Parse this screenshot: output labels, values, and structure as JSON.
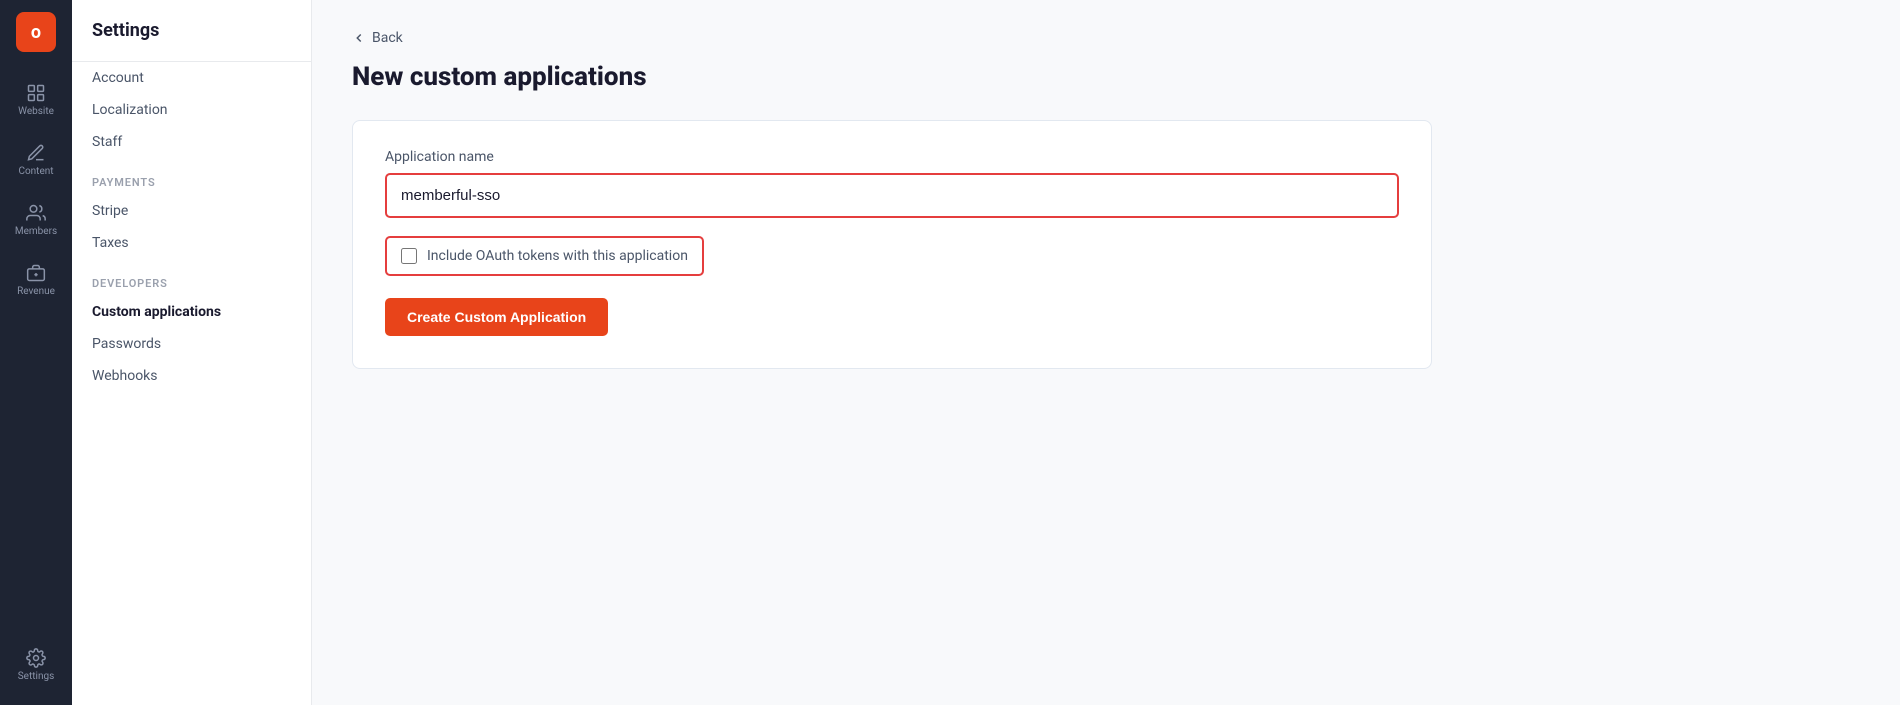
{
  "iconNav": {
    "logo": "o",
    "items": [
      {
        "id": "website",
        "label": "Website",
        "icon": "grid"
      },
      {
        "id": "content",
        "label": "Content",
        "icon": "edit"
      },
      {
        "id": "members",
        "label": "Members",
        "icon": "users"
      },
      {
        "id": "revenue",
        "label": "Revenue",
        "icon": "revenue"
      }
    ],
    "settings": {
      "label": "Settings",
      "icon": "gear"
    }
  },
  "sidebar": {
    "title": "Settings",
    "sections": [
      {
        "id": "account-section",
        "label": null,
        "items": [
          {
            "id": "account",
            "label": "Account",
            "active": false
          },
          {
            "id": "localization",
            "label": "Localization",
            "active": false
          },
          {
            "id": "staff",
            "label": "Staff",
            "active": false
          }
        ]
      },
      {
        "id": "payments-section",
        "label": "Payments",
        "items": [
          {
            "id": "stripe",
            "label": "Stripe",
            "active": false
          },
          {
            "id": "taxes",
            "label": "Taxes",
            "active": false
          }
        ]
      },
      {
        "id": "developers-section",
        "label": "Developers",
        "items": [
          {
            "id": "custom-applications",
            "label": "Custom applications",
            "active": true
          },
          {
            "id": "passwords",
            "label": "Passwords",
            "active": false
          },
          {
            "id": "webhooks",
            "label": "Webhooks",
            "active": false
          }
        ]
      }
    ]
  },
  "main": {
    "backLabel": "Back",
    "pageTitle": "New custom applications",
    "form": {
      "appNameLabel": "Application name",
      "appNameValue": "memberful-sso",
      "appNamePlaceholder": "",
      "checkboxLabel": "Include OAuth tokens with this application",
      "checkboxChecked": false,
      "submitLabel": "Create Custom Application"
    }
  }
}
